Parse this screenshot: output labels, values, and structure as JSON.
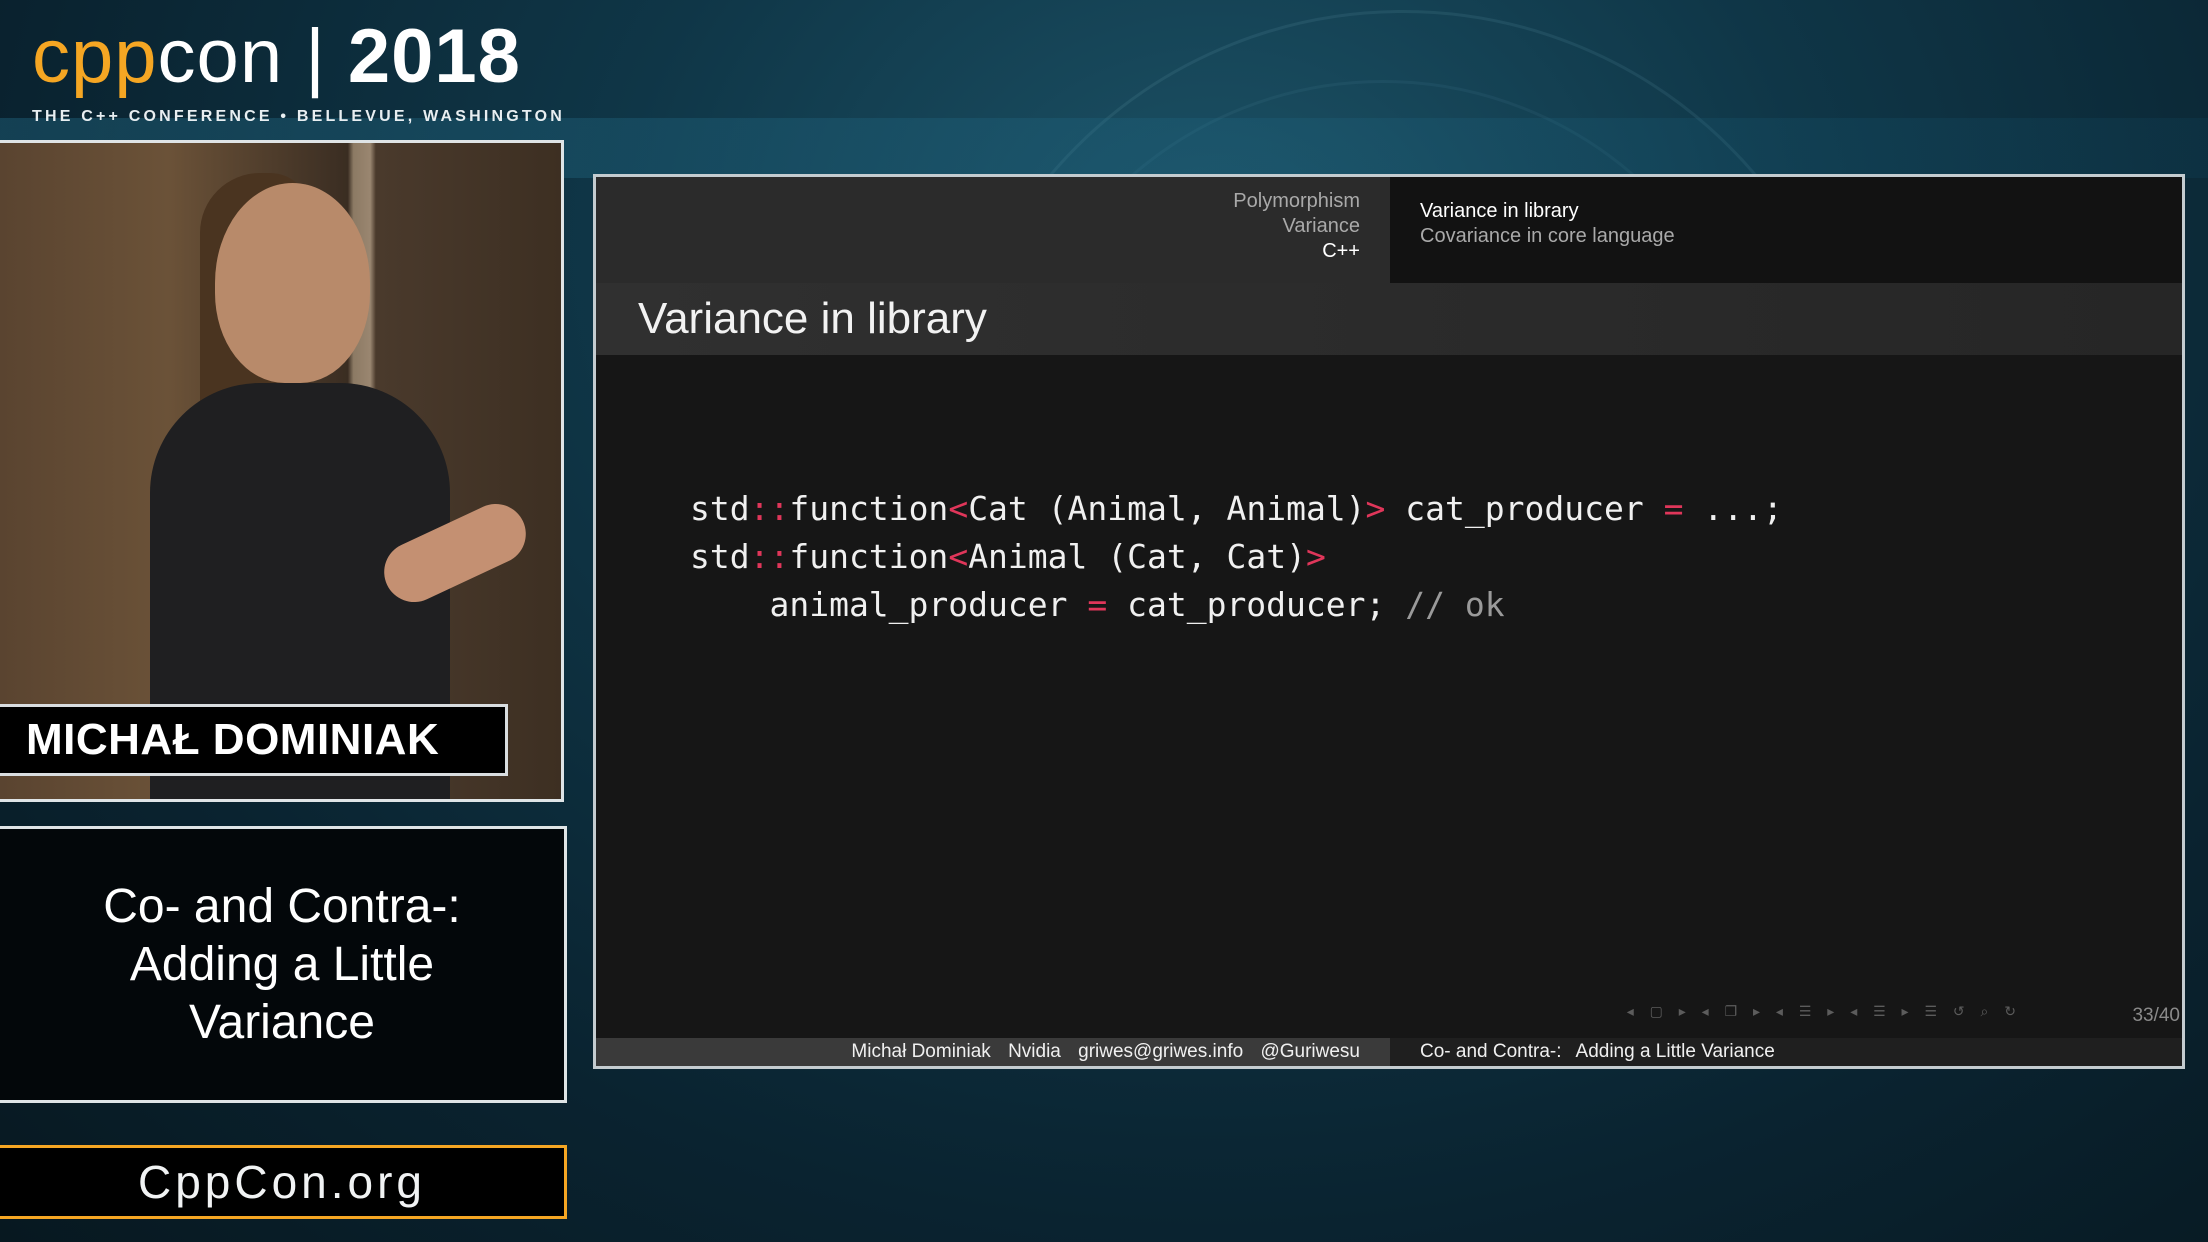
{
  "logo": {
    "part_cpp": "cpp",
    "part_con": "con",
    "separator": "|",
    "year": "2018",
    "tagline": "THE C++ CONFERENCE • BELLEVUE, WASHINGTON",
    "accent_color": "#f5a623"
  },
  "speaker": {
    "name": "MICHAŁ DOMINIAK"
  },
  "talk": {
    "title": "Co- and Contra-:\nAdding a Little\nVariance"
  },
  "site": {
    "url": "CppCon.org"
  },
  "slide": {
    "nav_sections": [
      "Polymorphism",
      "Variance",
      "C++"
    ],
    "nav_subsections": [
      "Variance in library",
      "Covariance in core language"
    ],
    "frame_title": "Variance in library",
    "code": {
      "l1_a": "std",
      "l1_b": "::",
      "l1_c": "function",
      "l1_d": "<",
      "l1_e": "Cat (Animal, Animal)",
      "l1_f": ">",
      "l1_g": " cat_producer ",
      "l1_h": "=",
      "l1_i": " ...;",
      "l2_a": "std",
      "l2_b": "::",
      "l2_c": "function",
      "l2_d": "<",
      "l2_e": "Animal (Cat, Cat)",
      "l2_f": ">",
      "l3_a": "    animal_producer ",
      "l3_b": "=",
      "l3_c": " cat_producer; ",
      "l3_d": "// ok"
    },
    "page_number": "33/40",
    "footer_author": [
      "Michał Dominiak",
      "Nvidia",
      "griwes@griwes.info",
      "@Guriwesu"
    ],
    "footer_title": [
      "Co- and Contra-:",
      "Adding a Little Variance"
    ]
  }
}
